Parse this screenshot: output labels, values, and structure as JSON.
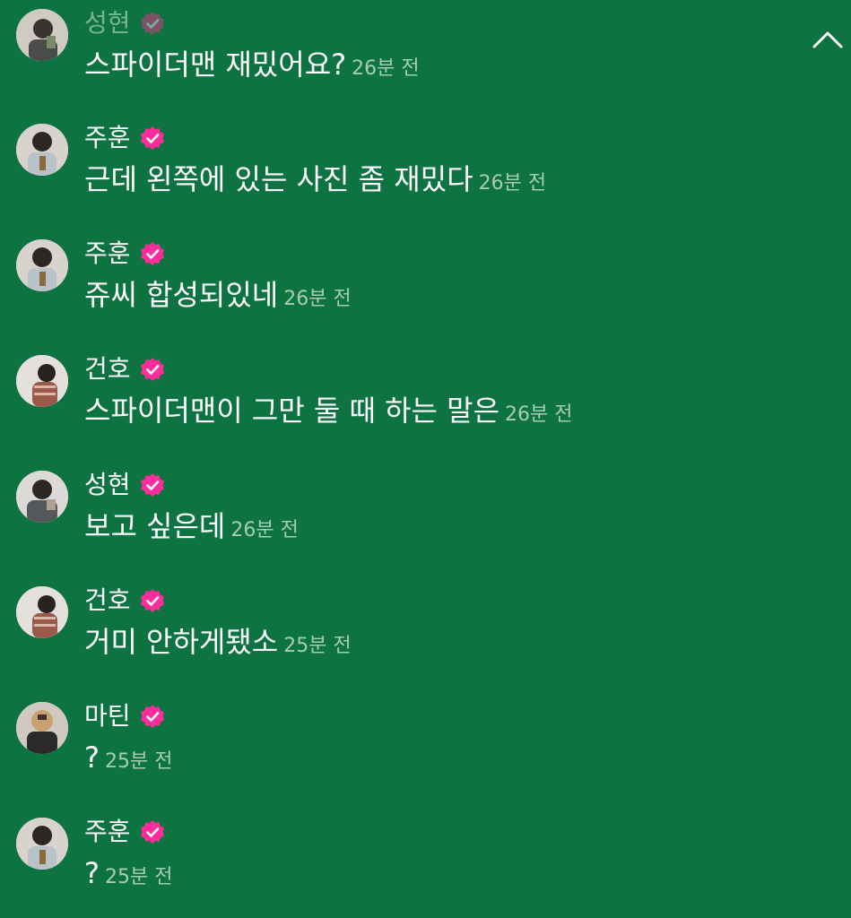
{
  "colors": {
    "background": "#0d7340",
    "name_text": "#ffffff",
    "message_text": "#ffffff",
    "timestamp_text": "#a7cbb7",
    "verified_badge": "#ff2d9b"
  },
  "header": {
    "collapse_icon": "chevron-up-icon"
  },
  "messages": [
    {
      "author": "성현",
      "text": "스파이더맨 재밌어요?",
      "time": "26분 전"
    },
    {
      "author": "주훈",
      "text": "근데 왼쪽에 있는 사진 좀 재밌다",
      "time": "26분 전"
    },
    {
      "author": "주훈",
      "text": "쥬씨 합성되있네",
      "time": "26분 전"
    },
    {
      "author": "건호",
      "text": "스파이더맨이 그만 둘 때 하는 말은",
      "time": "26분 전"
    },
    {
      "author": "성현",
      "text": "보고 싶은데",
      "time": "26분 전"
    },
    {
      "author": "건호",
      "text": "거미 안하게됐소",
      "time": "25분 전"
    },
    {
      "author": "마틴",
      "text": "?",
      "time": "25분 전"
    },
    {
      "author": "주훈",
      "text": "?",
      "time": "25분 전"
    }
  ]
}
